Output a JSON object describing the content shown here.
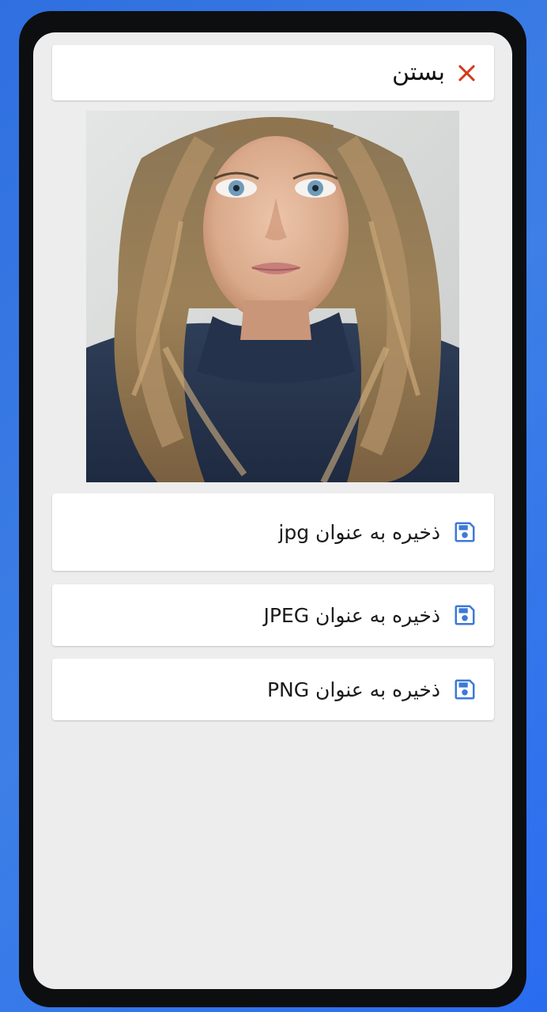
{
  "dialog": {
    "close_label": "بستن"
  },
  "image": {
    "description_icon": "portrait-photo"
  },
  "save_options": [
    {
      "label": "ذخیره به عنوان jpg",
      "icon": "floppy-save-icon"
    },
    {
      "label": "ذخیره به عنوان JPEG",
      "icon": "floppy-save-icon"
    },
    {
      "label": "ذخیره به عنوان PNG",
      "icon": "floppy-save-icon"
    }
  ],
  "colors": {
    "close_icon": "#d23b1c",
    "save_icon": "#3d79d8",
    "background_gradient": "#2f6fe0"
  }
}
